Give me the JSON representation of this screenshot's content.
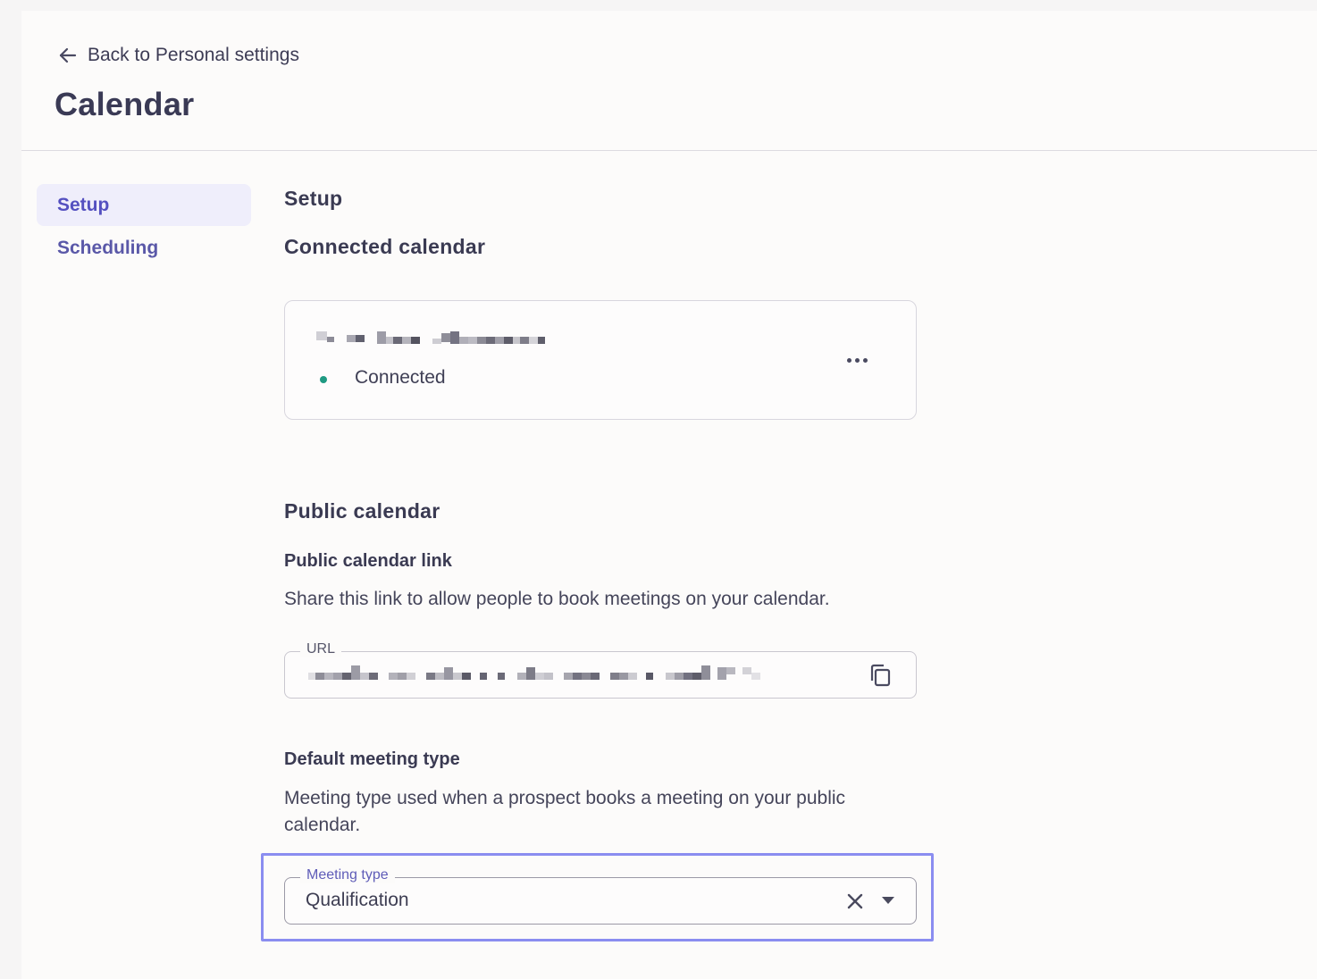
{
  "header": {
    "back_label": "Back to Personal settings",
    "title": "Calendar"
  },
  "sidebar": {
    "items": [
      {
        "label": "Setup",
        "active": true
      },
      {
        "label": "Scheduling",
        "active": false
      }
    ]
  },
  "main": {
    "setup_heading": "Setup",
    "connected_calendar": {
      "heading": "Connected calendar",
      "status": "Connected",
      "status_color": "#1f9a82"
    },
    "public_calendar": {
      "heading": "Public calendar",
      "link_label": "Public calendar link",
      "link_description": "Share this link to allow people to book meetings on your calendar.",
      "url_field_label": "URL"
    },
    "default_meeting": {
      "label": "Default meeting type",
      "description": "Meeting type used when a prospect books a meeting on your public calendar.",
      "select_label": "Meeting type",
      "select_value": "Qualification"
    }
  },
  "colors": {
    "accent": "#5450c0",
    "highlight": "#8a8df0"
  }
}
